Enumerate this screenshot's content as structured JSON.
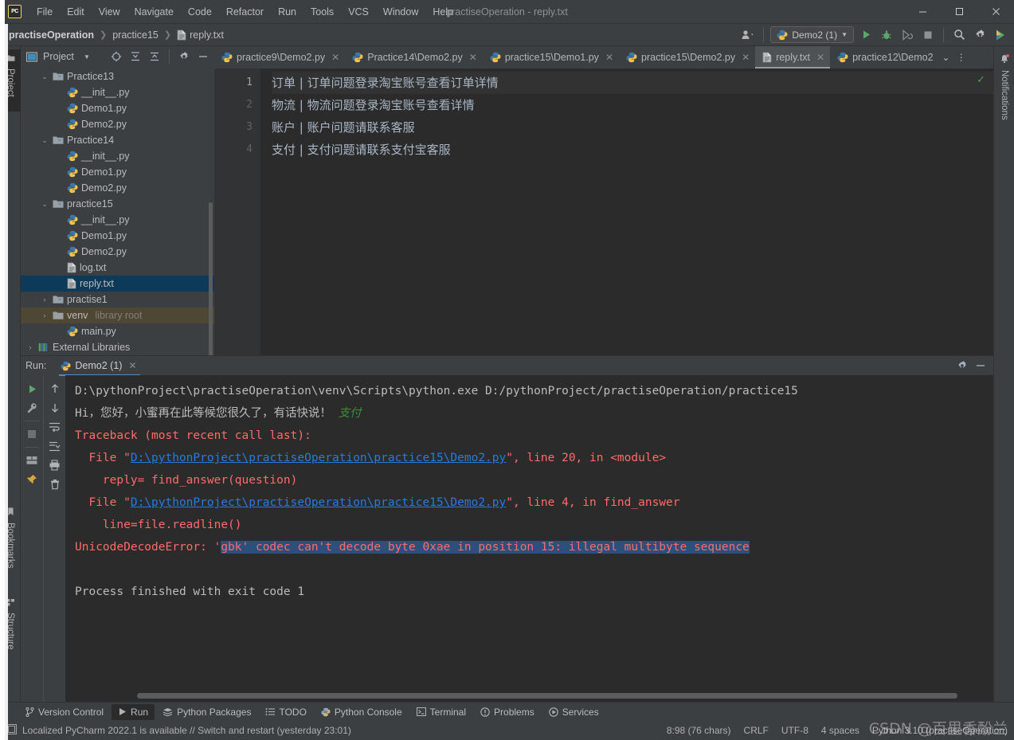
{
  "window": {
    "title": "practiseOperation - reply.txt",
    "app_logo": "PC",
    "minimize": "—",
    "maximize": "☐",
    "close": "✕"
  },
  "menubar": {
    "items": [
      "File",
      "Edit",
      "View",
      "Navigate",
      "Code",
      "Refactor",
      "Run",
      "Tools",
      "VCS",
      "Window",
      "Help"
    ]
  },
  "navbar": {
    "breadcrumbs": [
      "practiseOperation",
      "practice15",
      "reply.txt"
    ],
    "run_config": "Demo2 (1)",
    "icons": [
      "user-avatar-icon",
      "run-icon",
      "debug-icon",
      "coverage-icon",
      "stop-icon",
      "search-icon",
      "settings-icon",
      "assistant-icon"
    ]
  },
  "rails": {
    "left_top": "Project",
    "left_bottom": [
      "Bookmarks",
      "Structure"
    ],
    "right": "Notifications"
  },
  "project_panel": {
    "title": "Project",
    "tree": [
      {
        "label": "Practice13",
        "indent": 1,
        "type": "folder",
        "expanded": true
      },
      {
        "label": "__init__.py",
        "indent": 2,
        "type": "python"
      },
      {
        "label": "Demo1.py",
        "indent": 2,
        "type": "python"
      },
      {
        "label": "Demo2.py",
        "indent": 2,
        "type": "python"
      },
      {
        "label": "Practice14",
        "indent": 1,
        "type": "folder",
        "expanded": true
      },
      {
        "label": "__init__.py",
        "indent": 2,
        "type": "python"
      },
      {
        "label": "Demo1.py",
        "indent": 2,
        "type": "python"
      },
      {
        "label": "Demo2.py",
        "indent": 2,
        "type": "python"
      },
      {
        "label": "practice15",
        "indent": 1,
        "type": "folder",
        "expanded": true
      },
      {
        "label": "__init__.py",
        "indent": 2,
        "type": "python"
      },
      {
        "label": "Demo1.py",
        "indent": 2,
        "type": "python"
      },
      {
        "label": "Demo2.py",
        "indent": 2,
        "type": "python"
      },
      {
        "label": "log.txt",
        "indent": 2,
        "type": "text"
      },
      {
        "label": "reply.txt",
        "indent": 2,
        "type": "text",
        "selected": true
      },
      {
        "label": "practise1",
        "indent": 1,
        "type": "folder",
        "collapsed": true
      },
      {
        "label": "venv",
        "indent": 1,
        "type": "folder-plain",
        "collapsed": true,
        "dim": "library root",
        "highlight": true
      },
      {
        "label": "main.py",
        "indent": 2,
        "type": "python"
      },
      {
        "label": "External Libraries",
        "indent": 0,
        "type": "library",
        "collapsed": true
      }
    ]
  },
  "editor": {
    "tabs": [
      {
        "label": "practice9\\Demo2.py",
        "type": "python",
        "closable": true
      },
      {
        "label": "Practice14\\Demo2.py",
        "type": "python",
        "closable": true
      },
      {
        "label": "practice15\\Demo1.py",
        "type": "python",
        "closable": true
      },
      {
        "label": "practice15\\Demo2.py",
        "type": "python",
        "closable": true
      },
      {
        "label": "reply.txt",
        "type": "text",
        "closable": true,
        "active": true
      },
      {
        "label": "practice12\\Demo2",
        "type": "python",
        "closable": false
      }
    ],
    "line_numbers": [
      "1",
      "2",
      "3",
      "4"
    ],
    "lines": [
      "订单 | 订单问题登录淘宝账号查看订单详情",
      "物流 | 物流问题登录淘宝账号查看详情",
      "账户 | 账户问题请联系客服",
      "支付 | 支付问题请联系支付宝客服"
    ],
    "inspection_ok": "✓"
  },
  "run_panel": {
    "label": "Run:",
    "tab": "Demo2 (1)",
    "toolbar_left": [
      "rerun-icon",
      "wrench-icon",
      "stop-icon",
      "layout-icon",
      "pin-icon"
    ],
    "toolbar_right": [
      "up-arrow-icon",
      "down-arrow-icon",
      "soft-wrap-icon",
      "scroll-to-end-icon",
      "print-icon",
      "trash-icon"
    ],
    "console": [
      {
        "segments": [
          {
            "text": "D:\\pythonProject\\practiseOperation\\venv\\Scripts\\python.exe D:/pythonProject/practiseOperation/practice15",
            "style": "white"
          }
        ]
      },
      {
        "segments": [
          {
            "text": "Hi，您好，小蜜再在此等候您很久了，有话快说！ ",
            "style": "white"
          },
          {
            "text": "支付",
            "style": "green"
          }
        ]
      },
      {
        "segments": [
          {
            "text": "Traceback (most recent call last):",
            "style": "red"
          }
        ]
      },
      {
        "segments": [
          {
            "text": "  File \"",
            "style": "red"
          },
          {
            "text": "D:\\pythonProject\\practiseOperation\\practice15\\Demo2.py",
            "style": "link"
          },
          {
            "text": "\", line 20, in <module>",
            "style": "red"
          }
        ]
      },
      {
        "segments": [
          {
            "text": "    reply= find_answer(question)",
            "style": "red"
          }
        ]
      },
      {
        "segments": [
          {
            "text": "  File \"",
            "style": "red"
          },
          {
            "text": "D:\\pythonProject\\practiseOperation\\practice15\\Demo2.py",
            "style": "link"
          },
          {
            "text": "\", line 4, in find_answer",
            "style": "red"
          }
        ]
      },
      {
        "segments": [
          {
            "text": "    line=file.readline()",
            "style": "red"
          }
        ]
      },
      {
        "segments": [
          {
            "text": "UnicodeDecodeError: '",
            "style": "red"
          },
          {
            "text": "gbk' codec can't decode byte 0xae in position 15: illegal multibyte sequence",
            "style": "red-selected"
          }
        ]
      },
      {
        "segments": [
          {
            "text": "",
            "style": "white"
          }
        ]
      },
      {
        "segments": [
          {
            "text": "Process finished with exit code 1",
            "style": "white"
          }
        ]
      }
    ]
  },
  "toolwindow_bar": {
    "items": [
      {
        "label": "Version Control",
        "icon": "branch-icon"
      },
      {
        "label": "Run",
        "icon": "play-icon",
        "active": true
      },
      {
        "label": "Python Packages",
        "icon": "packages-icon"
      },
      {
        "label": "TODO",
        "icon": "todo-icon"
      },
      {
        "label": "Python Console",
        "icon": "python-console-icon"
      },
      {
        "label": "Terminal",
        "icon": "terminal-icon"
      },
      {
        "label": "Problems",
        "icon": "problems-icon"
      },
      {
        "label": "Services",
        "icon": "services-icon"
      }
    ]
  },
  "statusbar": {
    "message": "Localized PyCharm 2022.1 is available // Switch and restart (yesterday 23:01)",
    "caret": "8:98 (76 chars)",
    "line_sep": "CRLF",
    "encoding": "UTF-8",
    "indent": "4 spaces",
    "interpreter": "Python 3.10 (practiseOperation)"
  },
  "watermark": "CSDN @百里香酚兰",
  "colors": {
    "accent_blue": "#4a88c7",
    "selection": "#2d4f7c",
    "error_red": "#ff6b68",
    "link_blue": "#287bde",
    "green": "#3d8b3d",
    "tree_selected": "#0d3a58"
  }
}
